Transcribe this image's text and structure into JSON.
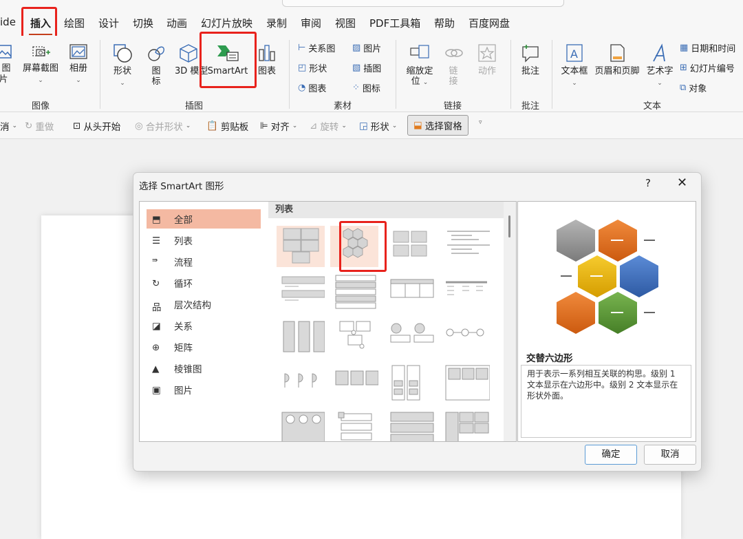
{
  "menu": {
    "items": [
      "ide",
      "插入",
      "绘图",
      "设计",
      "切换",
      "动画",
      "幻灯片放映",
      "录制",
      "审阅",
      "视图",
      "PDF工具箱",
      "帮助",
      "百度网盘"
    ]
  },
  "ribbon": {
    "images": {
      "pictures": "图片",
      "screenshot": "屏幕截图",
      "album": "相册",
      "group": "图像"
    },
    "illustrations": {
      "shapes": "形状",
      "icons": "图标",
      "model3d": "3D 模型",
      "smartart": "SmartArt",
      "chart": "图表",
      "group": "插图"
    },
    "material": {
      "relation": "关系图",
      "shape": "形状",
      "chart": "图表",
      "picture": "图片",
      "illustration": "插图",
      "icon": "图标",
      "group": "素材"
    },
    "links": {
      "zoom": "缩放定位",
      "link": "链接",
      "action": "动作",
      "group": "链接"
    },
    "comments": {
      "comment": "批注",
      "group": "批注"
    },
    "text": {
      "textbox": "文本框",
      "header_footer": "页眉和页脚",
      "wordart": "艺术字",
      "datetime": "日期和时间",
      "slide_number": "幻灯片编号",
      "object": "对象",
      "group": "文本"
    }
  },
  "quick_toolbar": {
    "undo": "消",
    "redo": "重做",
    "from_start": "从头开始",
    "merge_shapes": "合并形状",
    "clipboard": "剪贴板",
    "align": "对齐",
    "rotate": "旋转",
    "shape": "形状",
    "selection_pane": "选择窗格"
  },
  "dialog": {
    "title": "选择 SmartArt 图形",
    "help": "?",
    "close": "✕",
    "categories": [
      "全部",
      "列表",
      "流程",
      "循环",
      "层次结构",
      "关系",
      "矩阵",
      "棱锥图",
      "图片"
    ],
    "selected_category": "全部",
    "layout_header": "列表",
    "preview": {
      "name": "交替六边形",
      "description": "用于表示一系列相互关联的构思。级别 1 文本显示在六边形中。级别 2 文本显示在形状外面。"
    },
    "ok": "确定",
    "cancel": "取消"
  },
  "colors": {
    "highlight_red": "#e8221c",
    "selected_category": "#f4b9a2",
    "hex_gray": "#8e8e8e",
    "hex_orange": "#e06c1f",
    "hex_yellow": "#e8b100",
    "hex_blue": "#3d6fbd",
    "hex_green": "#5e9a3a"
  }
}
